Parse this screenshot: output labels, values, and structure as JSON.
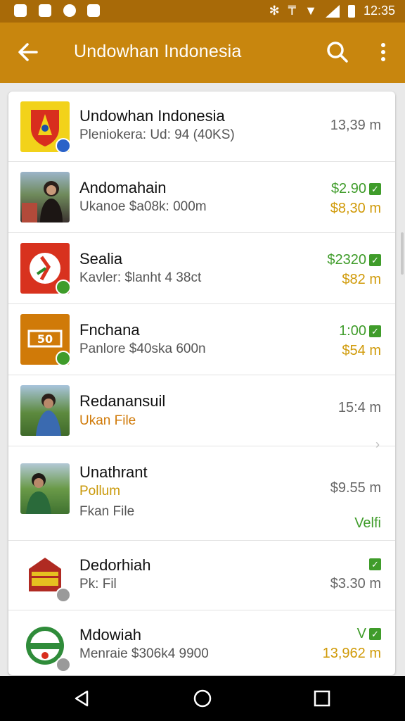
{
  "status_bar": {
    "time": "12:35"
  },
  "app_bar": {
    "title": "Undowhan Indonesia"
  },
  "rows": [
    {
      "name": "Undowhan Indonesia",
      "sub": "Pleniokera: Ud: 94 (40KS)",
      "right_top": "13,39 m",
      "right_bottom": ""
    },
    {
      "name": "Andomahain",
      "sub": "Ukanoe $a08k: 000m",
      "right_top": "$2.90",
      "right_bottom": "$8,30 m"
    },
    {
      "name": "Sealia",
      "sub": "Kavler: $lanht 4 38ct",
      "right_top": "$2320",
      "right_bottom": "$82 m"
    },
    {
      "name": "Fnchana",
      "sub": "Panlore $40ska 600n",
      "right_top": "1:00",
      "right_bottom": "$54 m"
    },
    {
      "name": "Redanansuil",
      "sub": "Ukan File",
      "right_top": "15:4 m",
      "right_bottom": ""
    },
    {
      "name": "Unathrant",
      "sub": "Pollum",
      "sub2": "Fkan File",
      "right_top": "$9.55 m",
      "right_bottom": "Velfi"
    },
    {
      "name": "Dedorhiah",
      "sub": "Pk: Fil",
      "right_top": "",
      "right_bottom": "$3.30 m"
    },
    {
      "name": "Mdowiah",
      "sub": "Menraie $306k4 9900",
      "right_top": "V",
      "right_bottom": "13,962 m"
    }
  ],
  "icons": {
    "back": "arrow-left-icon",
    "search": "search-icon",
    "more": "more-vertical-icon",
    "nav_back": "nav-back-icon",
    "nav_home": "nav-home-icon",
    "nav_recents": "nav-recents-icon"
  },
  "colors": {
    "status_bar": "#a86a08",
    "app_bar": "#c8860e",
    "green": "#3f9c2a",
    "gold": "#d09a08",
    "orange": "#d07a08"
  }
}
